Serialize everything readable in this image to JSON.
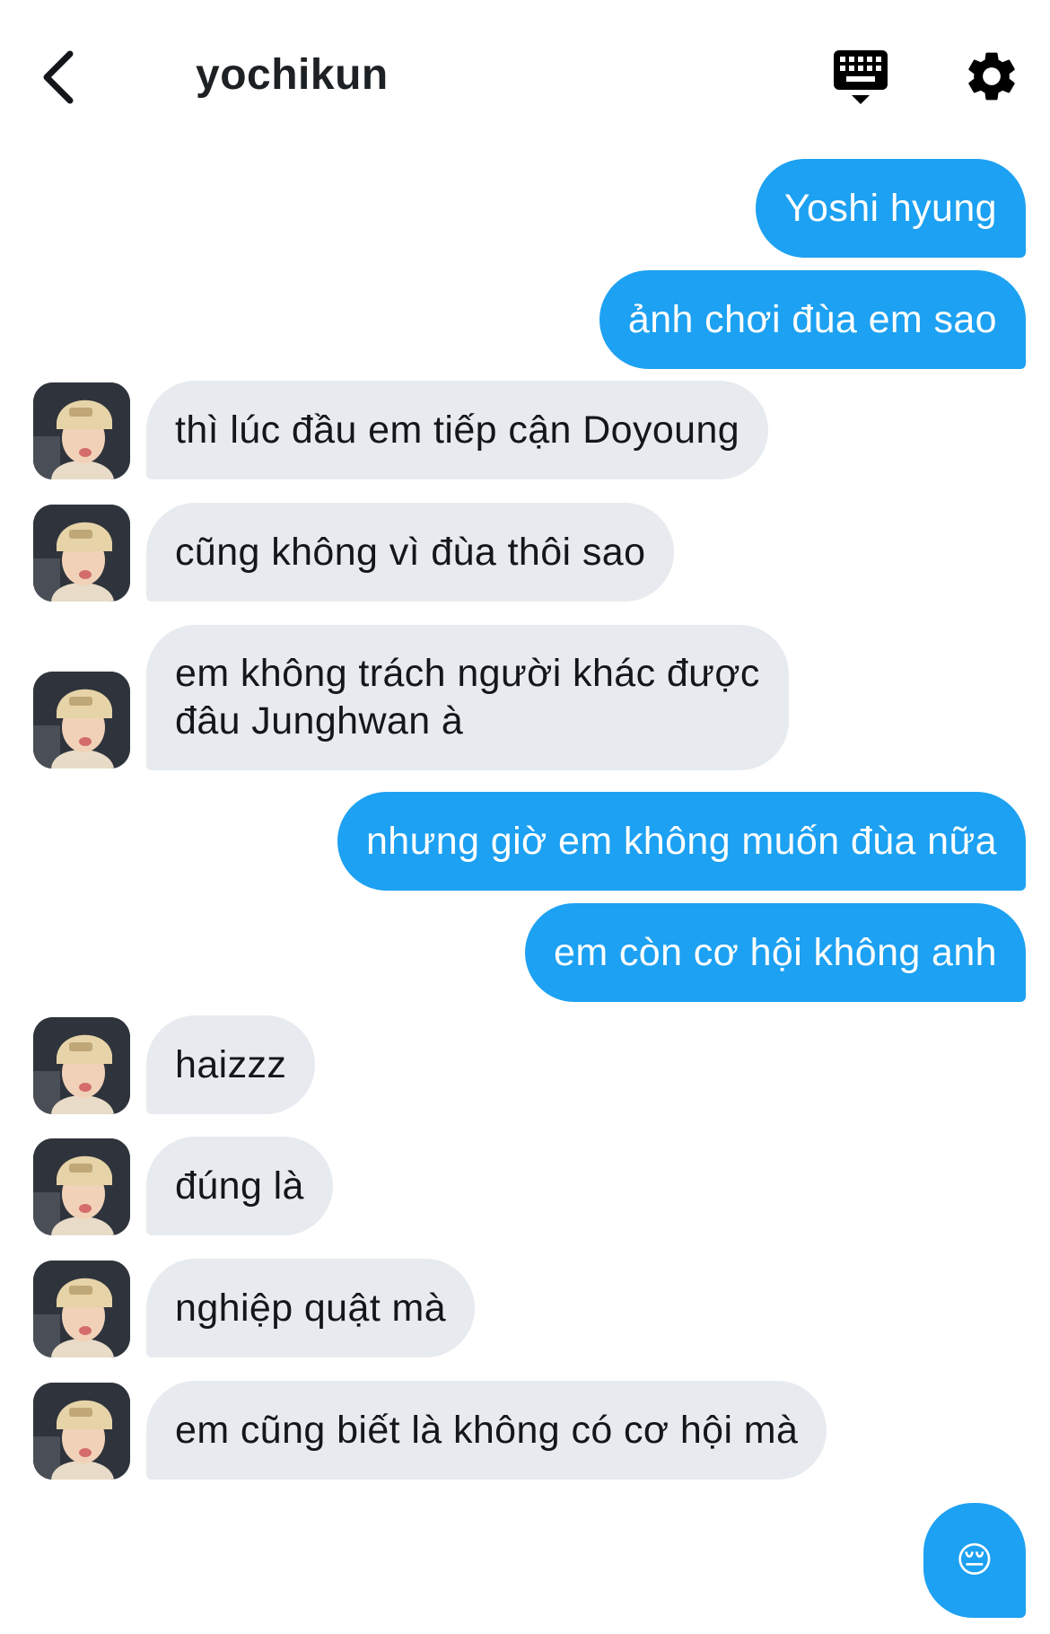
{
  "header": {
    "title": "yochikun",
    "back_icon": "chevron-left-icon",
    "keyboard_icon": "keyboard-icon",
    "settings_icon": "gear-icon"
  },
  "colors": {
    "sent_bubble": "#1da1f2",
    "received_bubble": "#e7ebef",
    "text": "#14171a"
  },
  "messages": [
    {
      "side": "sent",
      "text": "Yoshi hyung"
    },
    {
      "side": "sent",
      "text": "ảnh chơi đùa em sao"
    },
    {
      "side": "received",
      "text": "thì lúc đầu em tiếp cận Doyoung"
    },
    {
      "side": "received",
      "text": "cũng không vì đùa thôi sao"
    },
    {
      "side": "received",
      "line1": "em không trách người khác được",
      "line2": "đâu Junghwan à"
    },
    {
      "side": "sent",
      "text": "nhưng giờ em không muốn đùa nữa"
    },
    {
      "side": "sent",
      "text": "em còn cơ hội không anh"
    },
    {
      "side": "received",
      "text": "haizzz"
    },
    {
      "side": "received",
      "text": "đúng là"
    },
    {
      "side": "received",
      "text": "nghiệp quật mà"
    },
    {
      "side": "received",
      "text": "em cũng biết là không có cơ hội mà"
    },
    {
      "side": "sent",
      "text": "😔"
    }
  ]
}
